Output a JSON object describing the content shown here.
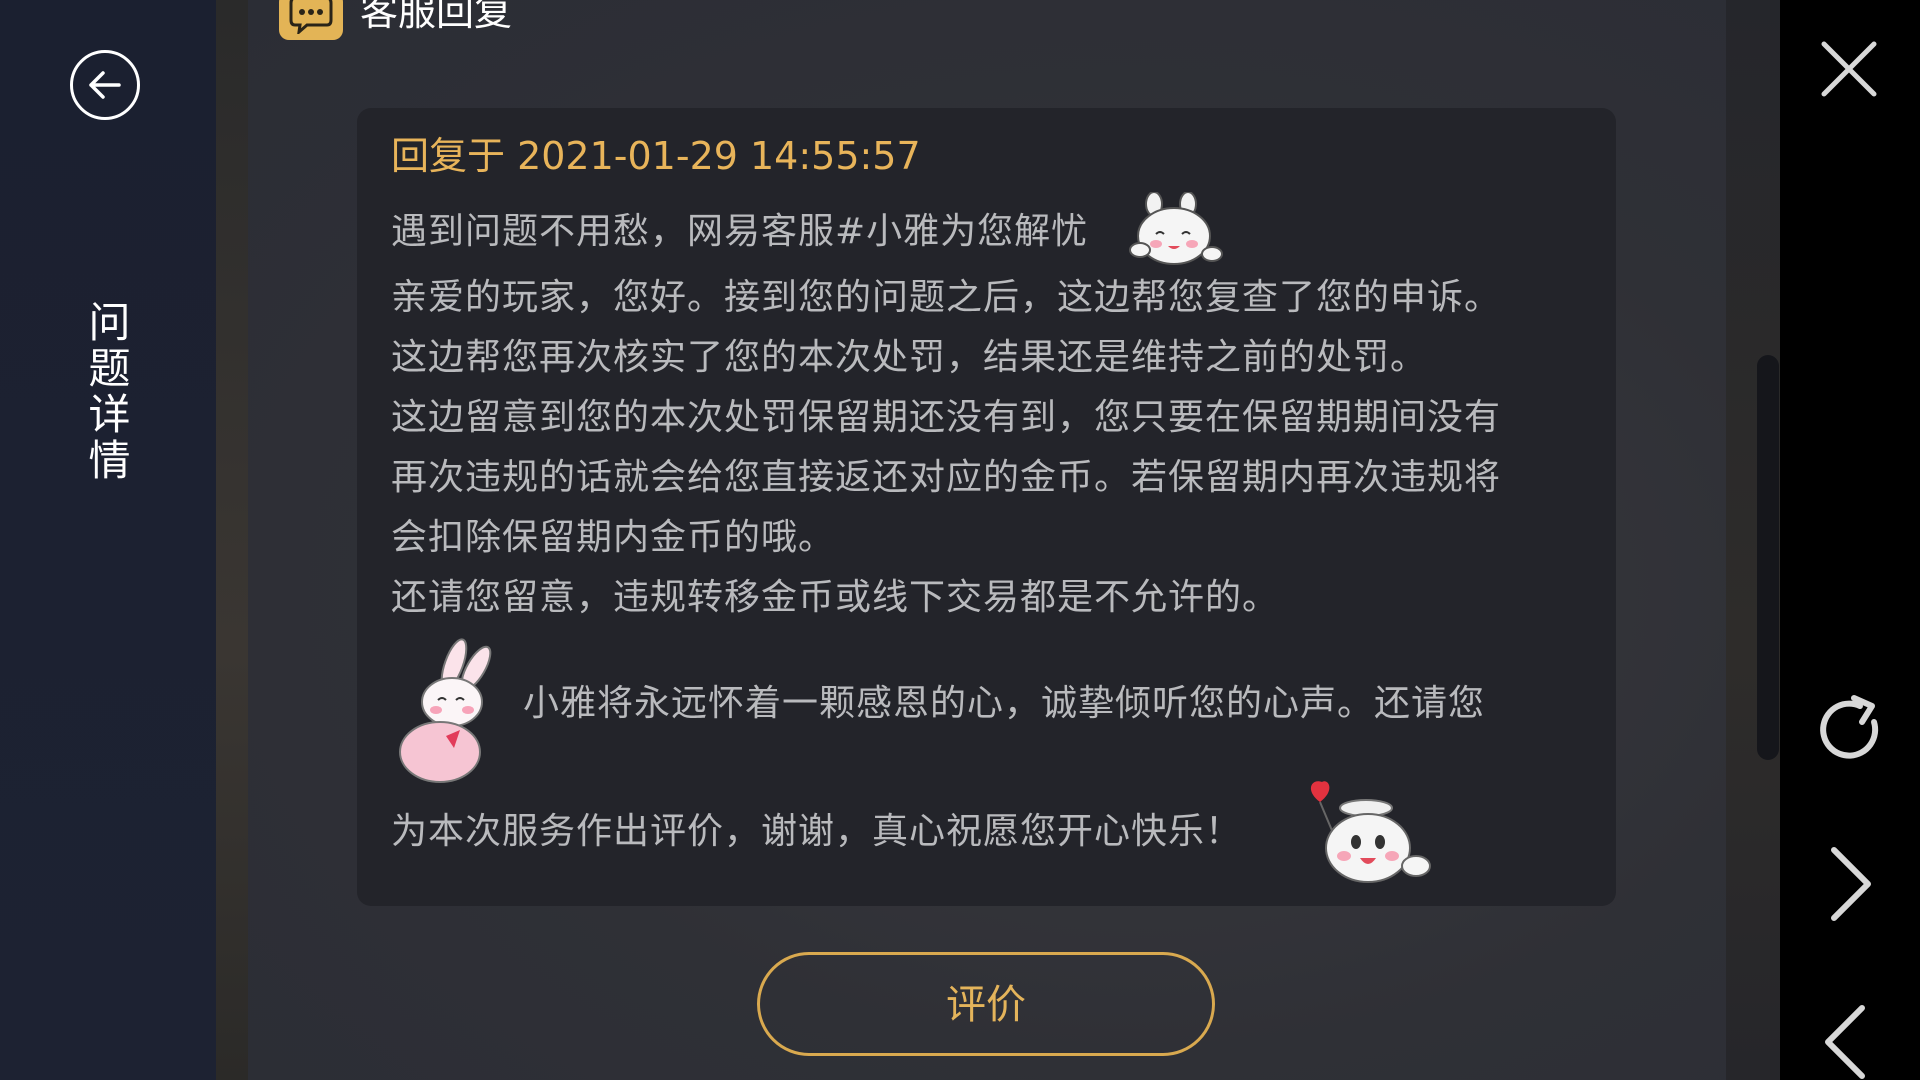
{
  "sidebar": {
    "title": "问题详情",
    "back_icon": "arrow-left-circle-icon"
  },
  "header": {
    "title": "客服回复",
    "icon": "chat-bubble-icon",
    "icon_color": "#e3b456"
  },
  "reply": {
    "time_label": "回复于 2021-01-29 14:55:57",
    "lines": [
      "遇到问题不用愁，网易客服#小雅为您解忧",
      "亲爱的玩家，您好。接到您的问题之后，这边帮您复查了您的申诉。",
      "这边帮您再次核实了您的本次处罚，结果还是维持之前的处罚。",
      "这边留意到您的本次处罚保留期还没有到，您只要在保留期期间没有",
      "再次违规的话就会给您直接返还对应的金币。若保留期内再次违规将",
      "会扣除保留期内金币的哦。",
      "还请您留意，违规转移金币或线下交易都是不允许的。",
      "小雅将永远怀着一颗感恩的心，诚挚倾听您的心声。还请您",
      "为本次服务作出评价，谢谢，真心祝愿您开心快乐！"
    ],
    "stickers": [
      "rabbit-blush-sticker",
      "rabbit-hug-sticker",
      "rabbit-balloon-sticker"
    ]
  },
  "rate_button": {
    "label": "评价"
  },
  "right_bar": {
    "close_icon": "close-icon",
    "refresh_icon": "refresh-icon",
    "forward_icon": "chevron-right-icon",
    "back_icon": "chevron-left-icon"
  },
  "colors": {
    "accent": "#e3b456",
    "text": "#b9babd",
    "sidebar": "#1b2030"
  }
}
